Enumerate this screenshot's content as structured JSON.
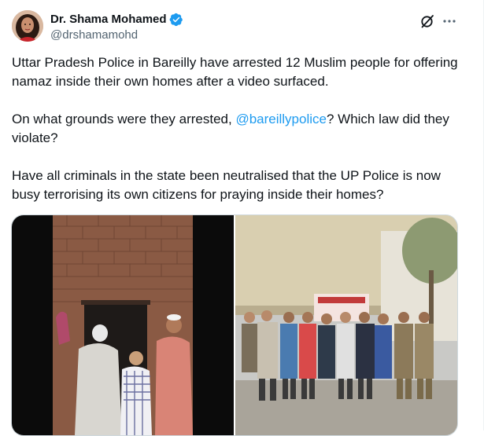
{
  "post": {
    "author": {
      "name": "Dr. Shama Mohamed",
      "handle": "@drshamamohd",
      "verified": true,
      "avatar_icon": "profile-photo"
    },
    "icons": {
      "grok": "grok-slash-circle-icon",
      "more": "more-horizontal-icon",
      "verified": "blue-verified-badge-icon"
    },
    "text": {
      "p1": "Uttar Pradesh Police in Bareilly have arrested 12 Muslim people for offering namaz inside their own homes after a video surfaced.",
      "p2_before": "On what grounds were they arrested, ",
      "p2_mention": "@bareillypolice",
      "p2_after": "? Which law did they violate?",
      "p3": "Have all criminals in the state been neutralised that the UP Police is now busy terrorising its own citizens for praying inside their homes?"
    },
    "media": {
      "count": 2,
      "items": [
        "video-frame-men-at-doorway",
        "photo-group-with-police"
      ]
    },
    "colors": {
      "link": "#1d9bf0",
      "verified": "#1d9bf0",
      "secondary_text": "#536471"
    }
  }
}
